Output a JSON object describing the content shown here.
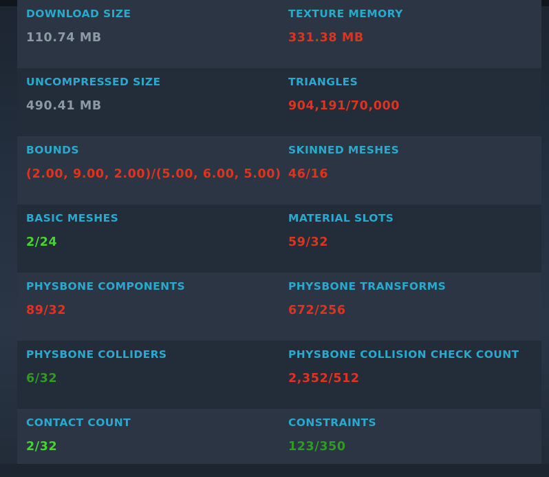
{
  "colors": {
    "label": "#2aa9cf",
    "neutral": "#8c9aa3",
    "bad": "#e0331f",
    "good": "#45d62b",
    "ok": "#2f9a24"
  },
  "stats": [
    {
      "label": "DOWNLOAD SIZE",
      "value": "110.74 MB",
      "status": "neutral"
    },
    {
      "label": "TEXTURE MEMORY",
      "value": "331.38 MB",
      "status": "bad"
    },
    {
      "label": "UNCOMPRESSED SIZE",
      "value": "490.41 MB",
      "status": "neutral"
    },
    {
      "label": "TRIANGLES",
      "value": "904,191/70,000",
      "status": "bad"
    },
    {
      "label": "BOUNDS",
      "value": "(2.00, 9.00, 2.00)/(5.00, 6.00, 5.00)",
      "status": "bad"
    },
    {
      "label": "SKINNED MESHES",
      "value": "46/16",
      "status": "bad"
    },
    {
      "label": "BASIC MESHES",
      "value": "2/24",
      "status": "good"
    },
    {
      "label": "MATERIAL SLOTS",
      "value": "59/32",
      "status": "bad"
    },
    {
      "label": "PHYSBONE COMPONENTS",
      "value": "89/32",
      "status": "bad"
    },
    {
      "label": "PHYSBONE TRANSFORMS",
      "value": "672/256",
      "status": "bad"
    },
    {
      "label": "PHYSBONE COLLIDERS",
      "value": "6/32",
      "status": "ok"
    },
    {
      "label": "PHYSBONE COLLISION CHECK COUNT",
      "value": "2,352/512",
      "status": "bad"
    },
    {
      "label": "CONTACT COUNT",
      "value": "2/32",
      "status": "good"
    },
    {
      "label": "CONSTRAINTS",
      "value": "123/350",
      "status": "ok"
    }
  ]
}
